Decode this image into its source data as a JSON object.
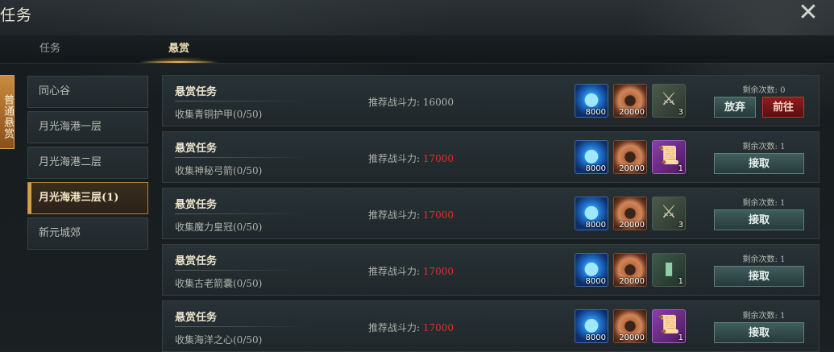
{
  "header": {
    "title": "任务",
    "close_icon": "close-icon"
  },
  "tabs": [
    {
      "label": "任务",
      "active": false
    },
    {
      "label": "悬赏",
      "active": true
    }
  ],
  "category": {
    "label": "普通悬赏"
  },
  "zones": [
    {
      "label": "同心谷",
      "active": false
    },
    {
      "label": "月光海港一层",
      "active": false
    },
    {
      "label": "月光海港二层",
      "active": false
    },
    {
      "label": "月光海港三层(1)",
      "active": true
    },
    {
      "label": "新元城郊",
      "active": false
    }
  ],
  "colors": {
    "accent_gold": "#e6b85a",
    "power_red": "#e0312a",
    "accept_button": "#3f5e5d",
    "go_button": "#8f1d1d"
  },
  "quests": [
    {
      "title": "悬赏任务",
      "desc": "收集青铜护甲(0/50)",
      "power_label": "推荐战斗力:",
      "power": "16000",
      "power_red": false,
      "rewards": [
        {
          "icon": "blue-orb-icon",
          "qty": "8000"
        },
        {
          "icon": "bronze-coin-icon",
          "qty": "20000"
        },
        {
          "icon": "armor-set-icon",
          "qty": "3"
        }
      ],
      "remain": "剩余次数: 0",
      "buttons": [
        "放弃",
        "前往"
      ]
    },
    {
      "title": "悬赏任务",
      "desc": "收集神秘弓箭(0/50)",
      "power_label": "推荐战斗力:",
      "power": "17000",
      "power_red": true,
      "rewards": [
        {
          "icon": "blue-orb-icon",
          "qty": "8000"
        },
        {
          "icon": "bronze-coin-icon",
          "qty": "20000"
        },
        {
          "icon": "scroll-icon",
          "qty": "1"
        }
      ],
      "remain": "剩余次数: 1",
      "buttons": [
        "接取"
      ]
    },
    {
      "title": "悬赏任务",
      "desc": "收集魔力皇冠(0/50)",
      "power_label": "推荐战斗力:",
      "power": "17000",
      "power_red": true,
      "rewards": [
        {
          "icon": "blue-orb-icon",
          "qty": "8000"
        },
        {
          "icon": "bronze-coin-icon",
          "qty": "20000"
        },
        {
          "icon": "armor-set-icon",
          "qty": "3"
        }
      ],
      "remain": "剩余次数: 1",
      "buttons": [
        "接取"
      ]
    },
    {
      "title": "悬赏任务",
      "desc": "收集古老箭囊(0/50)",
      "power_label": "推荐战斗力:",
      "power": "17000",
      "power_red": true,
      "rewards": [
        {
          "icon": "blue-orb-icon",
          "qty": "8000"
        },
        {
          "icon": "bronze-coin-icon",
          "qty": "20000"
        },
        {
          "icon": "green-book-icon",
          "qty": "1"
        }
      ],
      "remain": "剩余次数: 1",
      "buttons": [
        "接取"
      ]
    },
    {
      "title": "悬赏任务",
      "desc": "收集海洋之心(0/50)",
      "power_label": "推荐战斗力:",
      "power": "17000",
      "power_red": true,
      "rewards": [
        {
          "icon": "blue-orb-icon",
          "qty": "8000"
        },
        {
          "icon": "bronze-coin-icon",
          "qty": "20000"
        },
        {
          "icon": "scroll-icon",
          "qty": "1"
        }
      ],
      "remain": "剩余次数: 1",
      "buttons": [
        "接取"
      ]
    }
  ]
}
